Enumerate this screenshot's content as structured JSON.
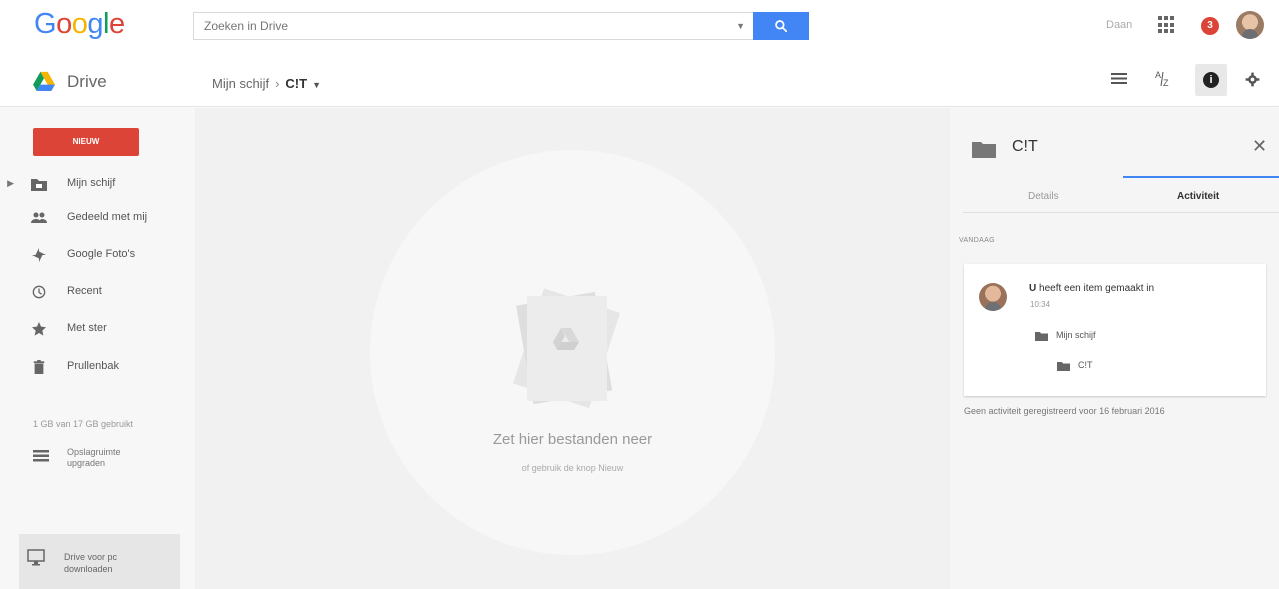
{
  "brand": {
    "logo_text": "Google",
    "logo_colors": [
      "#4285f4",
      "#db4437",
      "#f4b400",
      "#4285f4",
      "#0f9d58",
      "#db4437"
    ]
  },
  "search": {
    "placeholder": "Zoeken in Drive",
    "button_icon": "search-icon"
  },
  "account": {
    "name": "Daan",
    "notification_count": "3"
  },
  "header": {
    "app_name": "Drive",
    "breadcrumb": [
      "Mijn schijf",
      "C!T"
    ]
  },
  "sidebar": {
    "new_button": "NIEUW",
    "items": [
      {
        "label": "Mijn schijf",
        "icon": "my-drive-icon"
      },
      {
        "label": "Gedeeld met mij",
        "icon": "shared-icon"
      },
      {
        "label": "Google Foto's",
        "icon": "photos-icon"
      },
      {
        "label": "Recent",
        "icon": "clock-icon"
      },
      {
        "label": "Met ster",
        "icon": "star-icon"
      },
      {
        "label": "Prullenbak",
        "icon": "trash-icon"
      }
    ],
    "quota": "1 GB van 17 GB gebruikt",
    "upgrade_line1": "Opslagruimte",
    "upgrade_line2": "upgraden",
    "download_line1": "Drive voor pc",
    "download_line2": "downloaden"
  },
  "main": {
    "empty_title": "Zet hier bestanden neer",
    "empty_subtitle": "of gebruik de knop Nieuw"
  },
  "details_panel": {
    "title": "C!T",
    "tabs": [
      "Details",
      "Activiteit"
    ],
    "active_tab": "Activiteit",
    "date_header": "VANDAAG",
    "activity": {
      "actor": "U",
      "action": "heeft een item gemaakt in",
      "time": "10:34",
      "parent_folder": "Mijn schijf",
      "created_folder": "C!T"
    },
    "history_note": "Geen activiteit geregistreerd voor 16 februari 2016"
  }
}
